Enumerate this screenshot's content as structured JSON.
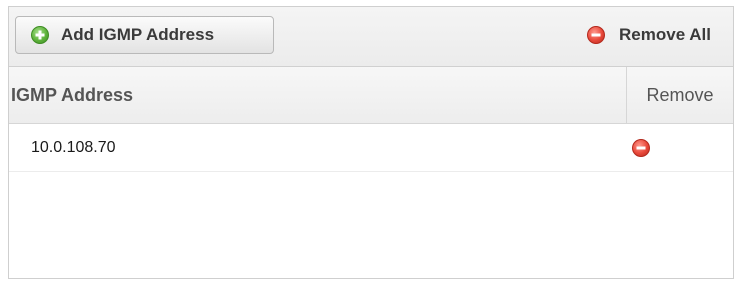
{
  "toolbar": {
    "add_label": "Add IGMP Address",
    "add_icon": "plus-circle-green-icon",
    "remove_all_label": "Remove All",
    "remove_all_icon": "minus-circle-red-icon"
  },
  "grid": {
    "columns": {
      "address": "IGMP Address",
      "remove": "Remove"
    },
    "rows": [
      {
        "address": "10.0.108.70",
        "remove_icon": "minus-circle-red-icon"
      }
    ]
  },
  "colors": {
    "add_icon": "#5fb33c",
    "remove_icon": "#e8483a",
    "border": "#cfcfcf"
  }
}
